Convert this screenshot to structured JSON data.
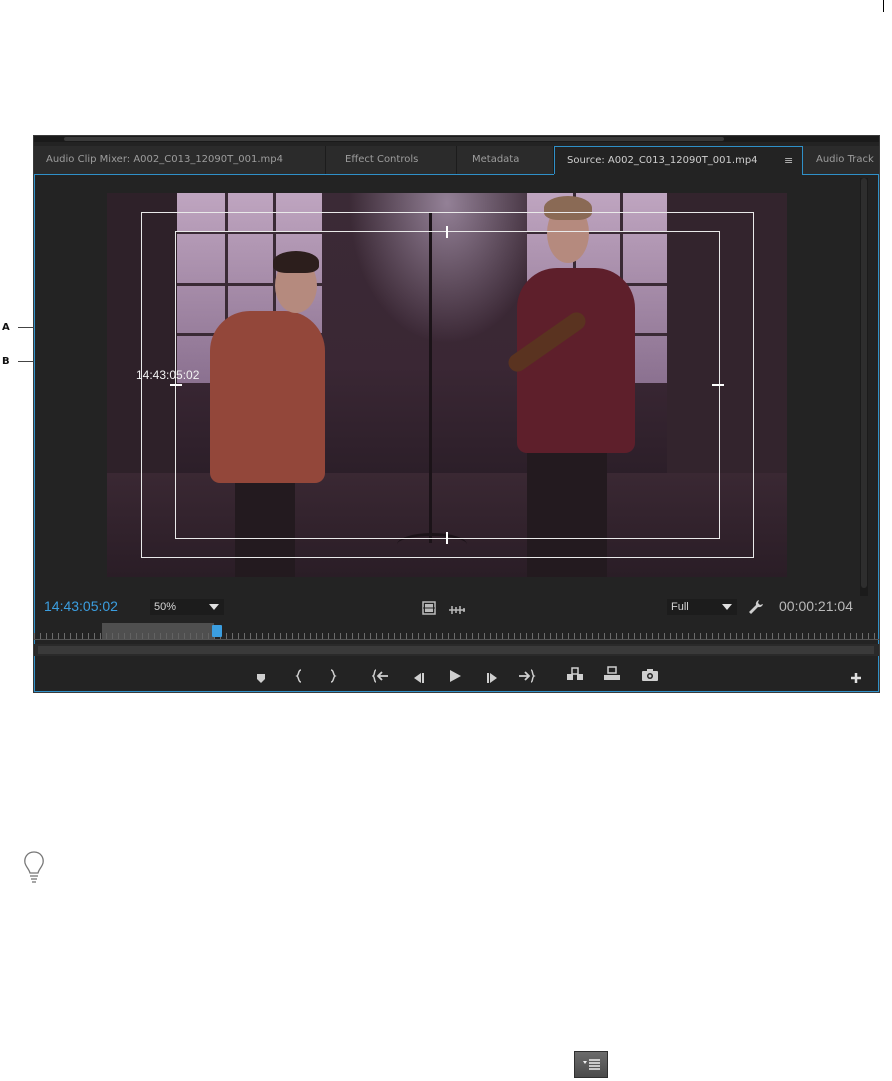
{
  "tabs": [
    {
      "label": "Audio Clip Mixer: A002_C013_12090T_001.mp4"
    },
    {
      "label": "Effect Controls"
    },
    {
      "label": "Metadata"
    },
    {
      "label": "Source: A002_C013_12090T_001.mp4",
      "active": true
    },
    {
      "label": "Audio Track"
    }
  ],
  "tab_menu_icon": "≡",
  "overlay": {
    "timecode": "14:43:05:02"
  },
  "controls": {
    "current_timecode": "14:43:05:02",
    "zoom_value": "50%",
    "resolution_value": "Full",
    "duration_timecode": "00:00:21:04",
    "settings_icon": "wrench-icon",
    "drag_video_icon": "film-strip-icon",
    "drag_audio_icon": "audio-waveform-icon"
  },
  "transport_icons": [
    "add-marker-icon",
    "mark-in-icon",
    "mark-out-icon",
    "go-to-in-icon",
    "step-back-icon",
    "play-icon",
    "step-forward-icon",
    "go-to-out-icon",
    "insert-icon",
    "overwrite-icon",
    "export-frame-icon",
    "button-editor-plus-icon"
  ],
  "callouts": {
    "a": "A",
    "b": "B"
  },
  "colors": {
    "accent_blue": "#3b9ee0",
    "panel_bg": "#232323",
    "active_tab_border": "#2f90c8"
  },
  "tip_icon": "lightbulb-icon",
  "panel_menu_icon": "panel-menu-icon"
}
